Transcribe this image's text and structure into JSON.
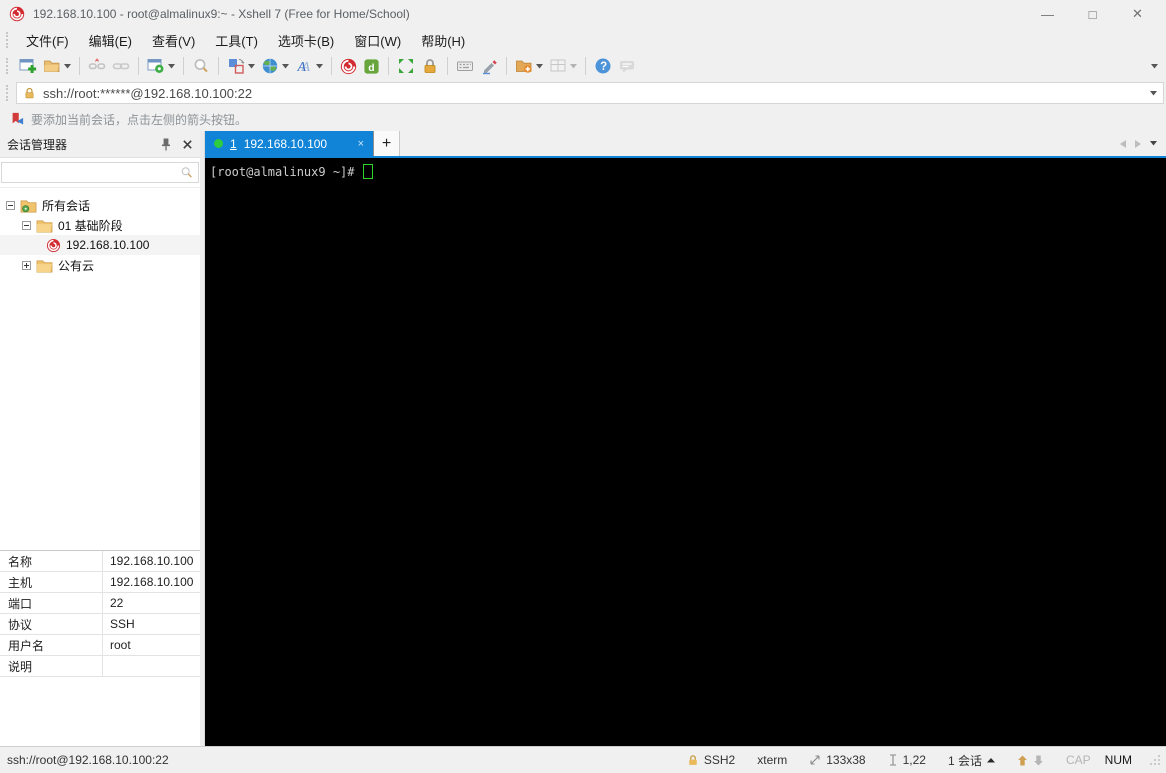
{
  "titlebar": {
    "title": "192.168.10.100 - root@almalinux9:~ - Xshell 7 (Free for Home/School)",
    "minimize": "—",
    "maximize": "□",
    "close": "✕"
  },
  "menu": {
    "items": [
      {
        "label": "文件(F)"
      },
      {
        "label": "编辑(E)"
      },
      {
        "label": "查看(V)"
      },
      {
        "label": "工具(T)"
      },
      {
        "label": "选项卡(B)"
      },
      {
        "label": "窗口(W)"
      },
      {
        "label": "帮助(H)"
      }
    ]
  },
  "toolbar": {
    "buttons": [
      "new-session",
      "open-folder",
      "disconnect",
      "reconnect",
      "session-properties",
      "find",
      "layout",
      "encoding",
      "font",
      "xshell",
      "xftp",
      "fullscreen",
      "lock-screen",
      "virtual-keyboard",
      "highlight",
      "new-file-folder",
      "tile-windows",
      "help",
      "feedback"
    ]
  },
  "address_bar": {
    "value": "ssh://root:******@192.168.10.100:22"
  },
  "info_bar": {
    "message": "要添加当前会话，点击左侧的箭头按钮。"
  },
  "session_manager": {
    "title": "会话管理器",
    "search_value": "",
    "tree": [
      {
        "label": "所有会话",
        "level": 0,
        "expanded": true,
        "icon": "sessions-root-folder"
      },
      {
        "label": "01 基础阶段",
        "level": 1,
        "expanded": true,
        "icon": "folder"
      },
      {
        "label": "192.168.10.100",
        "level": 2,
        "expanded": null,
        "icon": "xshell-session"
      },
      {
        "label": "公有云",
        "level": 1,
        "expanded": false,
        "icon": "folder"
      }
    ],
    "properties": [
      {
        "label": "名称",
        "value": "192.168.10.100"
      },
      {
        "label": "主机",
        "value": "192.168.10.100"
      },
      {
        "label": "端口",
        "value": "22"
      },
      {
        "label": "协议",
        "value": "SSH"
      },
      {
        "label": "用户名",
        "value": "root"
      },
      {
        "label": "说明",
        "value": ""
      }
    ]
  },
  "tab_bar": {
    "active_tab": {
      "index": "1",
      "label": "192.168.10.100",
      "close_glyph": "×",
      "status_color": "#2ecc40"
    },
    "new_tab_glyph": "+"
  },
  "terminal": {
    "prompt": "[root@almalinux9 ~]#"
  },
  "status_bar": {
    "connection": "ssh://root@192.168.10.100:22",
    "protocol": "SSH2",
    "terminal_type": "xterm",
    "screen_size": "133x38",
    "cursor_position": "1,22",
    "session_count": "1 会话",
    "caps_lock": "CAP",
    "num_lock": "NUM"
  },
  "colors": {
    "tab_active_bg": "#1184d8",
    "terminal_bg": "#000000",
    "terminal_fg": "#cccccc",
    "cursor_green": "#2bd42b",
    "session_dot_green": "#2ecc40",
    "xshell_red": "#d22b31",
    "folder_yellow": "#f0c36d",
    "chrome_gray": "#f0f0f0"
  }
}
